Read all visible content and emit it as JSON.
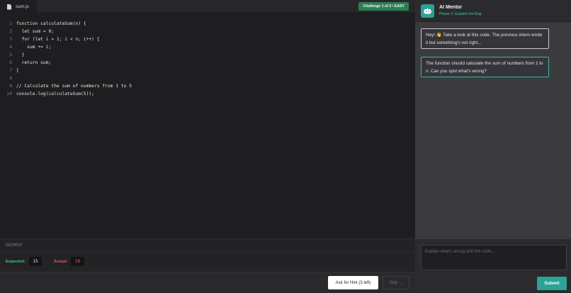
{
  "editor": {
    "tab_label": "sum.js",
    "challenge_badge": "Challenge 1 of 3 • EASY",
    "lines": [
      {
        "no": "1",
        "code": "function calculateSum(n) {"
      },
      {
        "no": "2",
        "code": "  let sum = 0;"
      },
      {
        "no": "3",
        "code": "  for (let i = 1; i < n; i++) {"
      },
      {
        "no": "4",
        "code": "    sum += i;"
      },
      {
        "no": "5",
        "code": "  }"
      },
      {
        "no": "6",
        "code": "  return sum;"
      },
      {
        "no": "7",
        "code": "}"
      },
      {
        "no": "8",
        "code": ""
      },
      {
        "no": "9",
        "code": "// Calculate the sum of numbers from 1 to 5"
      },
      {
        "no": "10",
        "code": "console.log(calculateSum(5));"
      }
    ]
  },
  "output": {
    "title": "OUTPUT",
    "expected_label": "Expected:",
    "expected_value": "15",
    "actual_label": "Actual:",
    "actual_value": "10"
  },
  "actions": {
    "hint_label": "Ask for Hint (3 left)",
    "skip_label": "Skip →"
  },
  "mentor": {
    "name": "AI Mentor",
    "phase": "Phase 1: Explain the Bug",
    "messages": [
      "Hey! 👋 Take a look at this code. The previous intern wrote it but something's not right...",
      "The function should calculate the sum of numbers from 1 to n. Can you spot what's wrong?"
    ],
    "input_placeholder": "Explain what's wrong with the code...",
    "submit_label": "Submit"
  },
  "colors": {
    "accent": "#2aa394",
    "badge": "#2f7d57",
    "expected": "#49c08a",
    "actual": "#e05858"
  }
}
